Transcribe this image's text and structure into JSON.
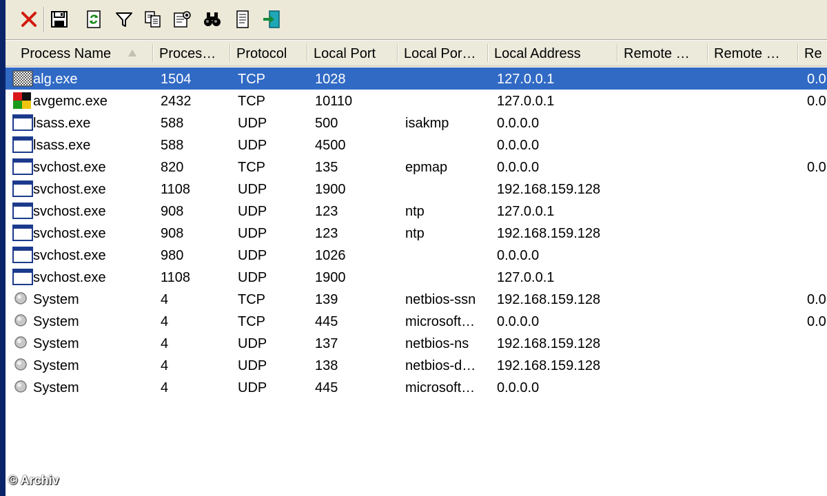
{
  "toolbar": {
    "buttons": [
      {
        "icon": "close-icon"
      },
      {
        "icon": "save-icon"
      },
      {
        "icon": "refresh-icon"
      },
      {
        "icon": "filter-icon"
      },
      {
        "icon": "copy-icon"
      },
      {
        "icon": "properties-icon"
      },
      {
        "icon": "find-icon"
      },
      {
        "icon": "report-icon"
      },
      {
        "icon": "exit-icon"
      }
    ]
  },
  "columns": [
    "Process Name",
    "Proces…",
    "Protocol",
    "Local Port",
    "Local Por…",
    "Local Address",
    "Remote …",
    "Remote …",
    "Re"
  ],
  "rows": [
    {
      "name": "alg.exe",
      "pid": "1504",
      "protocol": "TCP",
      "local_port": "1028",
      "local_port_name": "",
      "local_address": "127.0.0.1",
      "remote_address": "",
      "remote_port": "",
      "extra": "0.0",
      "icon": "alg-process-icon",
      "selected": true
    },
    {
      "name": "avgemc.exe",
      "pid": "2432",
      "protocol": "TCP",
      "local_port": "10110",
      "local_port_name": "",
      "local_address": "127.0.0.1",
      "remote_address": "",
      "remote_port": "",
      "extra": "0.0",
      "icon": "avg-process-icon",
      "selected": false
    },
    {
      "name": "lsass.exe",
      "pid": "588",
      "protocol": "UDP",
      "local_port": "500",
      "local_port_name": "isakmp",
      "local_address": "0.0.0.0",
      "remote_address": "",
      "remote_port": "",
      "extra": "",
      "icon": "window-process-icon",
      "selected": false
    },
    {
      "name": "lsass.exe",
      "pid": "588",
      "protocol": "UDP",
      "local_port": "4500",
      "local_port_name": "",
      "local_address": "0.0.0.0",
      "remote_address": "",
      "remote_port": "",
      "extra": "",
      "icon": "window-process-icon",
      "selected": false
    },
    {
      "name": "svchost.exe",
      "pid": "820",
      "protocol": "TCP",
      "local_port": "135",
      "local_port_name": "epmap",
      "local_address": "0.0.0.0",
      "remote_address": "",
      "remote_port": "",
      "extra": "0.0",
      "icon": "window-process-icon",
      "selected": false
    },
    {
      "name": "svchost.exe",
      "pid": "1108",
      "protocol": "UDP",
      "local_port": "1900",
      "local_port_name": "",
      "local_address": "192.168.159.128",
      "remote_address": "",
      "remote_port": "",
      "extra": "",
      "icon": "window-process-icon",
      "selected": false
    },
    {
      "name": "svchost.exe",
      "pid": "908",
      "protocol": "UDP",
      "local_port": "123",
      "local_port_name": "ntp",
      "local_address": "127.0.0.1",
      "remote_address": "",
      "remote_port": "",
      "extra": "",
      "icon": "window-process-icon",
      "selected": false
    },
    {
      "name": "svchost.exe",
      "pid": "908",
      "protocol": "UDP",
      "local_port": "123",
      "local_port_name": "ntp",
      "local_address": "192.168.159.128",
      "remote_address": "",
      "remote_port": "",
      "extra": "",
      "icon": "window-process-icon",
      "selected": false
    },
    {
      "name": "svchost.exe",
      "pid": "980",
      "protocol": "UDP",
      "local_port": "1026",
      "local_port_name": "",
      "local_address": "0.0.0.0",
      "remote_address": "",
      "remote_port": "",
      "extra": "",
      "icon": "window-process-icon",
      "selected": false
    },
    {
      "name": "svchost.exe",
      "pid": "1108",
      "protocol": "UDP",
      "local_port": "1900",
      "local_port_name": "",
      "local_address": "127.0.0.1",
      "remote_address": "",
      "remote_port": "",
      "extra": "",
      "icon": "window-process-icon",
      "selected": false
    },
    {
      "name": "System",
      "pid": "4",
      "protocol": "TCP",
      "local_port": "139",
      "local_port_name": "netbios-ssn",
      "local_address": "192.168.159.128",
      "remote_address": "",
      "remote_port": "",
      "extra": "0.0",
      "icon": "system-process-icon",
      "selected": false
    },
    {
      "name": "System",
      "pid": "4",
      "protocol": "TCP",
      "local_port": "445",
      "local_port_name": "microsoft…",
      "local_address": "0.0.0.0",
      "remote_address": "",
      "remote_port": "",
      "extra": "0.0",
      "icon": "system-process-icon",
      "selected": false
    },
    {
      "name": "System",
      "pid": "4",
      "protocol": "UDP",
      "local_port": "137",
      "local_port_name": "netbios-ns",
      "local_address": "192.168.159.128",
      "remote_address": "",
      "remote_port": "",
      "extra": "",
      "icon": "system-process-icon",
      "selected": false
    },
    {
      "name": "System",
      "pid": "4",
      "protocol": "UDP",
      "local_port": "138",
      "local_port_name": "netbios-d…",
      "local_address": "192.168.159.128",
      "remote_address": "",
      "remote_port": "",
      "extra": "",
      "icon": "system-process-icon",
      "selected": false
    },
    {
      "name": "System",
      "pid": "4",
      "protocol": "UDP",
      "local_port": "445",
      "local_port_name": "microsoft…",
      "local_address": "0.0.0.0",
      "remote_address": "",
      "remote_port": "",
      "extra": "",
      "icon": "system-process-icon",
      "selected": false
    }
  ],
  "watermark": "© Archiv",
  "colors": {
    "selection": "#316ac5",
    "toolbar": "#ece9d8",
    "header": "#ebeadb",
    "frame": "#0a246a"
  }
}
